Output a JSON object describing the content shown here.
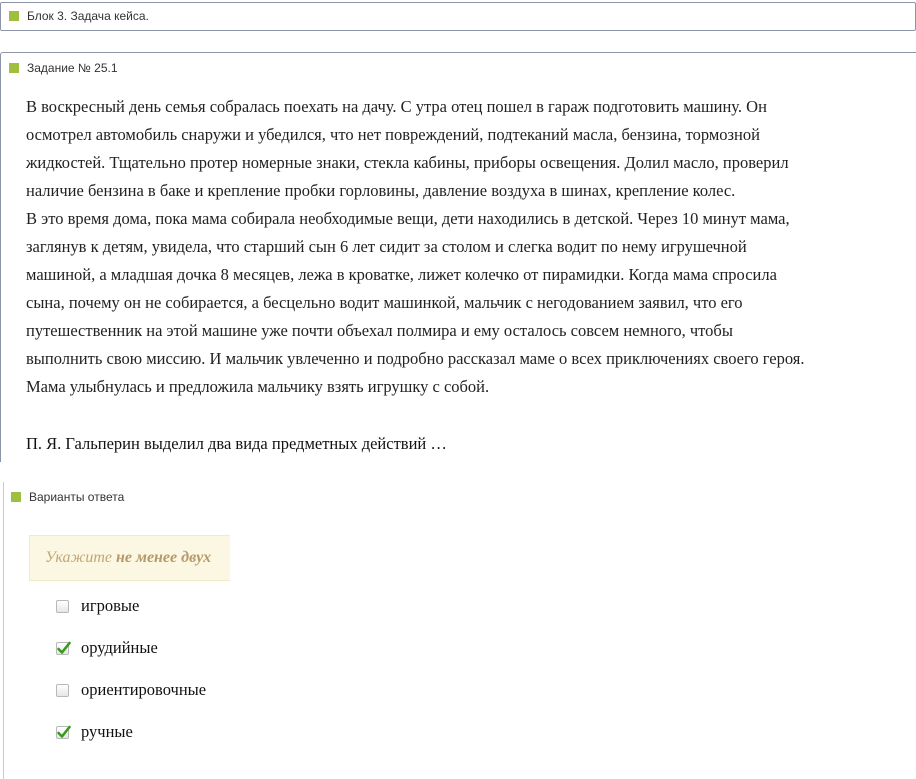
{
  "block_header": {
    "title": "Блок 3. Задача кейса."
  },
  "task": {
    "title": "Задание № 25.1",
    "paragraph_lines": [
      "В воскресный день семья собралась поехать на дачу. С утра отец пошел в гараж подготовить машину. Он",
      "осмотрел автомобиль снаружи и убедился, что нет повреждений, подтеканий масла, бензина, тормозной",
      "жидкостей. Тщательно протер номерные знаки, стекла кабины, приборы освещения. Долил масло, проверил",
      "наличие бензина в баке и крепление пробки горловины, давление воздуха в шинах, крепление колес.",
      "В это время дома, пока мама собирала необходимые вещи, дети находились в детской. Через 10 минут мама,",
      "заглянув к детям, увидела, что старший сын 6 лет сидит за столом и слегка водит по нему игрушечной",
      "машиной, а младшая дочка 8 месяцев, лежа в кроватке, лижет колечко от пирамидки. Когда мама спросила",
      "сына, почему он не собирается, а бесцельно водит машинкой, мальчик с негодованием заявил, что его",
      "путешественник на этой машине уже почти объехал полмира и ему осталось совсем немного, чтобы",
      "выполнить свою миссию. И мальчик увлеченно и подробно рассказал маме о всех приключениях своего героя.",
      "Мама улыбнулась и предложила мальчику взять игрушку с собой."
    ],
    "question": "П. Я. Гальперин выделил два вида предметных действий …"
  },
  "answers": {
    "title": "Варианты ответа",
    "hint_prefix": "Укажите ",
    "hint_bold": "не менее двух",
    "options": [
      {
        "label": "игровые",
        "checked": false
      },
      {
        "label": "орудийные",
        "checked": true
      },
      {
        "label": "ориентировочные",
        "checked": false
      },
      {
        "label": "ручные",
        "checked": true
      }
    ]
  },
  "colors": {
    "accent_square": "#a0bf3f",
    "checkmark": "#3a9a1e",
    "hint_background": "#fcf7e3",
    "panel_border": "#8d95a8"
  }
}
